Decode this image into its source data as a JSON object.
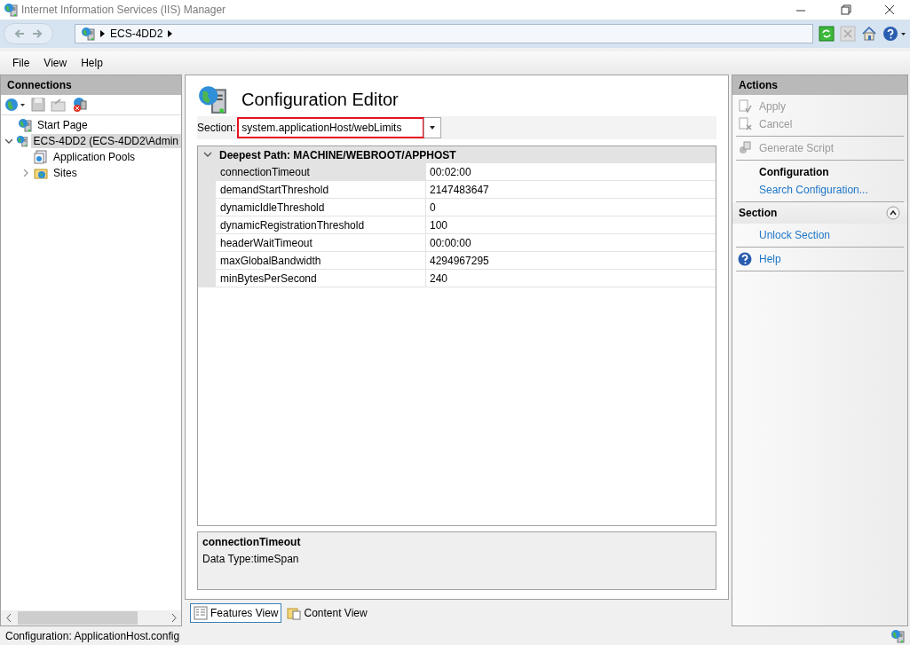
{
  "window": {
    "title": "Internet Information Services (IIS) Manager"
  },
  "address": {
    "crumbs": [
      "ECS-4DD2"
    ]
  },
  "menu": [
    "File",
    "View",
    "Help"
  ],
  "connections": {
    "title": "Connections",
    "tree": [
      {
        "label": "Start Page",
        "selected": false
      },
      {
        "label": "ECS-4DD2 (ECS-4DD2\\Admin",
        "selected": true,
        "expanded": true,
        "children": [
          {
            "label": "Application Pools",
            "selected": false
          },
          {
            "label": "Sites",
            "selected": false,
            "expanded": false
          }
        ]
      }
    ]
  },
  "editor": {
    "title": "Configuration Editor",
    "section_label": "Section:",
    "section_value": "system.applicationHost/webLimits",
    "highlighted": true,
    "group": {
      "title": "Deepest Path: MACHINE/WEBROOT/APPHOST",
      "expanded": true
    },
    "rows": [
      {
        "name": "connectionTimeout",
        "value": "00:02:00",
        "selected": true
      },
      {
        "name": "demandStartThreshold",
        "value": "2147483647",
        "selected": false
      },
      {
        "name": "dynamicIdleThreshold",
        "value": "0",
        "selected": false
      },
      {
        "name": "dynamicRegistrationThreshold",
        "value": "100",
        "selected": false
      },
      {
        "name": "headerWaitTimeout",
        "value": "00:00:00",
        "selected": false
      },
      {
        "name": "maxGlobalBandwidth",
        "value": "4294967295",
        "selected": false
      },
      {
        "name": "minBytesPerSecond",
        "value": "240",
        "selected": false
      }
    ],
    "details": {
      "name": "connectionTimeout",
      "text": "Data Type:timeSpan"
    }
  },
  "views": [
    {
      "label": "Features View",
      "selected": true
    },
    {
      "label": "Content View",
      "selected": false
    }
  ],
  "actions": {
    "title": "Actions",
    "groups": [
      [
        {
          "kind": "apply",
          "label": "Apply",
          "disabled": true
        },
        {
          "kind": "cancel",
          "label": "Cancel",
          "disabled": true
        }
      ],
      [
        {
          "kind": "script",
          "label": "Generate Script",
          "disabled": true
        }
      ],
      [
        {
          "kind": "heading",
          "label": "Configuration"
        },
        {
          "kind": "link",
          "label": "Search Configuration...",
          "disabled": false
        }
      ]
    ],
    "section": {
      "title": "Section",
      "expanded": true,
      "groups": [
        [
          {
            "kind": "link",
            "label": "Unlock Section",
            "disabled": false
          }
        ],
        [
          {
            "kind": "help",
            "label": "Help",
            "disabled": false
          }
        ]
      ]
    }
  },
  "status_bar": {
    "text": "Configuration: ApplicationHost.config"
  }
}
